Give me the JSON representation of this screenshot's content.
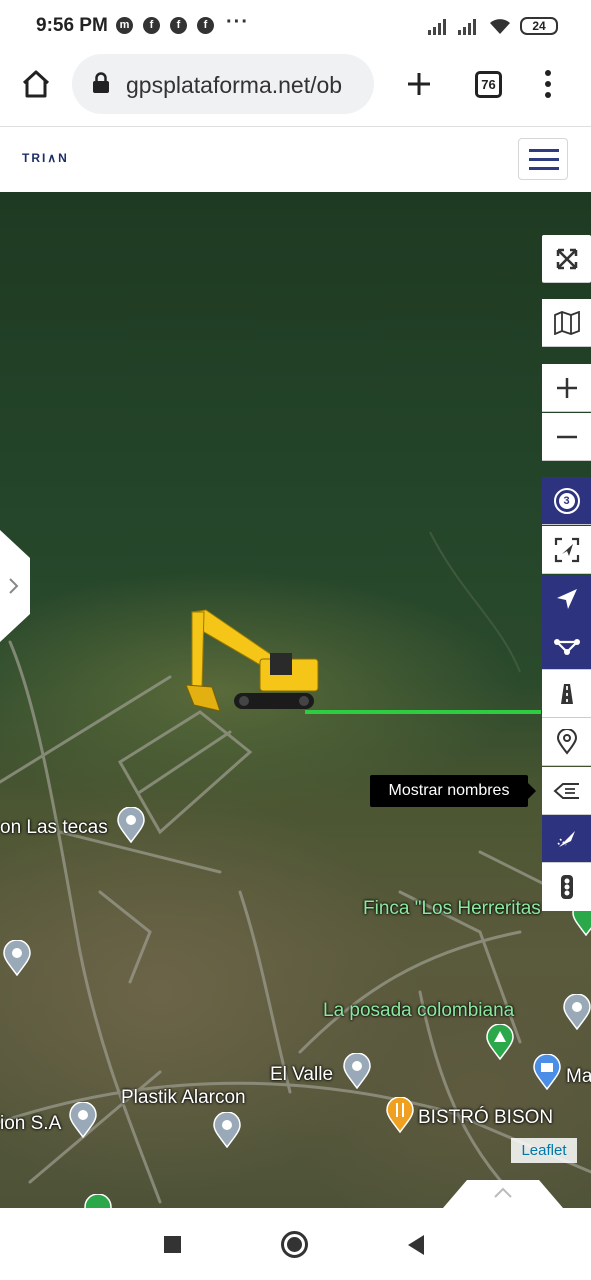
{
  "status": {
    "time": "9:56 PM",
    "more": "···",
    "battery": "24"
  },
  "browser": {
    "url": "gpsplataforma.net/ob",
    "tab_count": "76"
  },
  "app": {
    "logo": "TRI∧N"
  },
  "map": {
    "tooltip": "Mostrar nombres",
    "attribution": "Leaflet",
    "controls": {
      "cluster_count": "3"
    },
    "places": [
      {
        "name": "on Las tecas",
        "style": "white"
      },
      {
        "name": "Finca \"Los Herreritas",
        "style": "green"
      },
      {
        "name": "La posada colombiana",
        "style": "green"
      },
      {
        "name": "El Valle",
        "style": "white"
      },
      {
        "name": "Ma",
        "style": "white"
      },
      {
        "name": "Plastik Alarcon",
        "style": "white"
      },
      {
        "name": "ion S.A",
        "style": "white"
      },
      {
        "name": "BISTRÓ BISON",
        "style": "white"
      }
    ],
    "vehicle": {
      "type": "excavator-icon",
      "accent": "#f5c518"
    },
    "track_color": "#2ecc40"
  },
  "colors": {
    "brand": "#2e3380"
  }
}
